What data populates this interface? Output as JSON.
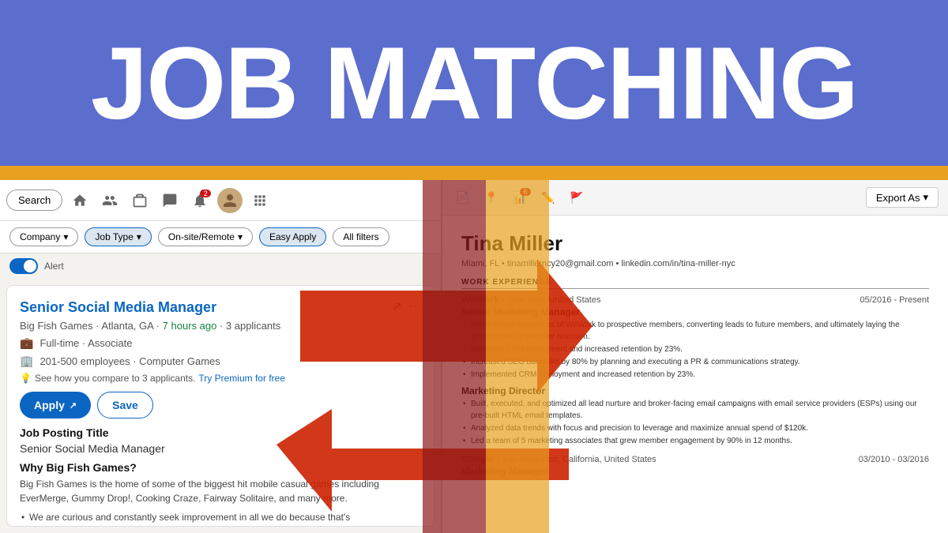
{
  "hero": {
    "title": "JOB MATCHING"
  },
  "linkedin": {
    "search_label": "Search",
    "filter_company": "Company",
    "filter_job_type": "Job Type",
    "filter_remote": "On-site/Remote",
    "filter_easy_apply": "Easy Apply",
    "filter_all": "All filters",
    "job_title": "Senior Social Media Manager",
    "company": "Big Fish Games",
    "location": "Atlanta, GA",
    "time_posted": "7 hours ago",
    "applicants": "3 applicants",
    "employment_type": "Full-time · Associate",
    "company_size": "201-500 employees · Computer Games",
    "compare_note": "See how you compare to 3 applicants.",
    "premium_link": "Try Premium for free",
    "apply_label": "Apply",
    "save_label": "Save",
    "job_posting_section": "Job Posting Title",
    "job_posting_value": "Senior Social Media Manager",
    "why_section": "Why Big Fish Games?",
    "desc": "Big Fish Games is the home of some of the biggest hit mobile casual games including EverMerge, Gummy Drop!, Cooking Craze, Fairway Solitaire, and many more.",
    "bullet_1": "We are curious and constantly seek improvement in all we do because that's"
  },
  "resume": {
    "name": "Tina Miller",
    "contact": "Miami, FL • tinamillerncy20@gmail.com • linkedin.com/in/tina-miller-nyc",
    "work_experience_label": "WORK EXPERIENCE",
    "wework_company": "WeWork",
    "wework_location": "New York, United States",
    "wework_dates": "05/2016 - Present",
    "wework_role": "Senior Marketing Manager",
    "wework_bullet1": "Drove brand awareness of WeWork to prospective members, converting leads to future members, and ultimately laying the groundwork for member retention.",
    "wework_bullet2": "Managed CRM deployment and increased retention by 23%.",
    "wework_bullet3": "Increased SEO backlinks by 80% by planning and executing a PR & communications strategy.",
    "wework_bullet4": "Implemented CRM deployment and increased retention by 23%.",
    "marketing_director_role": "Marketing Director",
    "marketing_bullet1": "Built, executed, and optimized all lead nurture and broker-facing email campaigns with email service providers (ESPs) using our pre-built HTML email templates.",
    "marketing_bullet2": "Analyzed data trends with focus and precision to leverage and maximize annual spend of $120k.",
    "marketing_bullet3": "Led a team of 5 marketing associates that grew member engagement by 90% in 12 months.",
    "google_company": "Google",
    "google_location": "San Francisco, California, United States",
    "google_dates": "03/2010 - 03/2016",
    "google_role": "Marketing Manager",
    "export_label": "Export As"
  }
}
